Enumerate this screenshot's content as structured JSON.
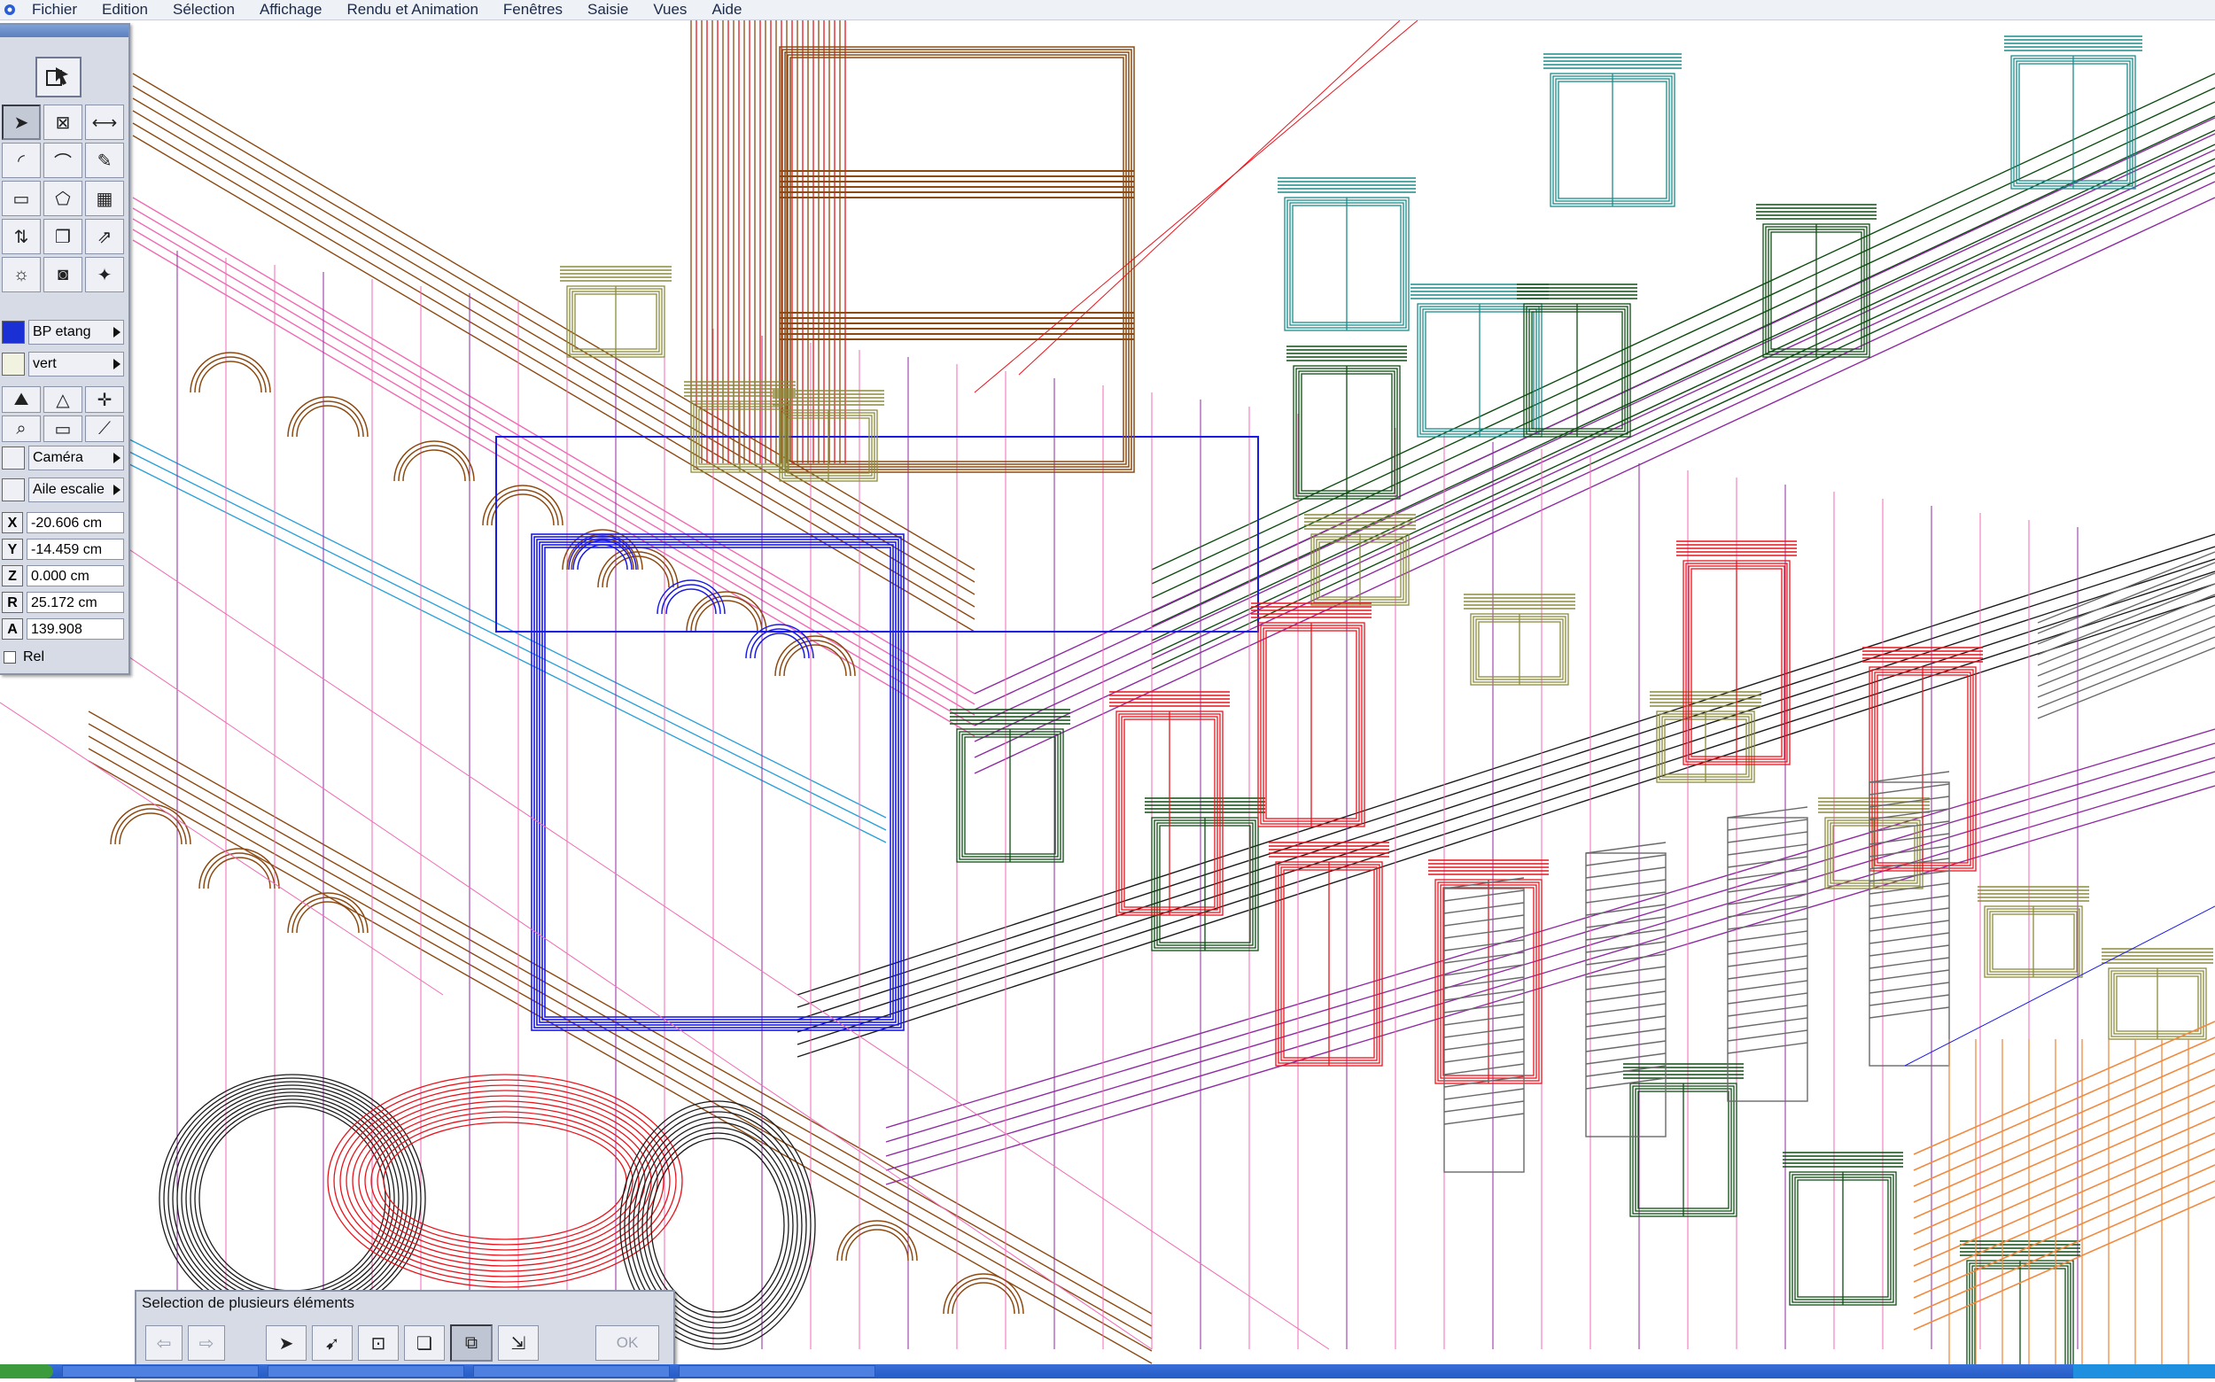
{
  "menubar": {
    "app_icon": "app-icon",
    "items": [
      "Fichier",
      "Edition",
      "Sélection",
      "Affichage",
      "Rendu et Animation",
      "Fenêtres",
      "Saisie",
      "Vues",
      "Aide"
    ]
  },
  "palette": {
    "tools": [
      "arrow-select-icon",
      "box-icon",
      "dimension-icon",
      "arc-icon",
      "curve-icon",
      "wrench-icon",
      "solid-icon",
      "shape-icon",
      "mesh-icon",
      "move-icon",
      "copy-icon",
      "scale-icon",
      "light-icon",
      "camera-icon",
      "walk-icon"
    ],
    "layer": {
      "name": "BP etang",
      "color": "#1a2fd4"
    },
    "material": {
      "name": "vert",
      "color": "#f2f2e0"
    },
    "camera_label": "Caméra",
    "view_label": "Aile escalie",
    "coords": [
      {
        "axis": "X",
        "value": "-20.606 cm"
      },
      {
        "axis": "Y",
        "value": "-14.459 cm"
      },
      {
        "axis": "Z",
        "value": "0.000 cm"
      },
      {
        "axis": "R",
        "value": "25.172 cm"
      },
      {
        "axis": "A",
        "value": "139.908"
      }
    ],
    "rel_label": "Rel"
  },
  "selection_dialog": {
    "title": "Selection de plusieurs éléments",
    "ok_label": "OK",
    "mode_icons": [
      "arrow-select-icon",
      "arrow-plus-icon",
      "lasso-icon",
      "solid-select-icon",
      "group-select-icon",
      "stretch-icon"
    ]
  },
  "colors": {
    "teal": "#1a8c8c",
    "dark_green": "#0e4d12",
    "red": "#e8141c",
    "blue": "#1a1ae6",
    "purple": "#8f2aa3",
    "olive": "#8c8c3c",
    "brown": "#8c4a12",
    "pink": "#f06ab4",
    "black": "#1a1a1a",
    "orange": "#f08a40",
    "gray": "#6a6a6a",
    "sky": "#2aa0d8"
  }
}
